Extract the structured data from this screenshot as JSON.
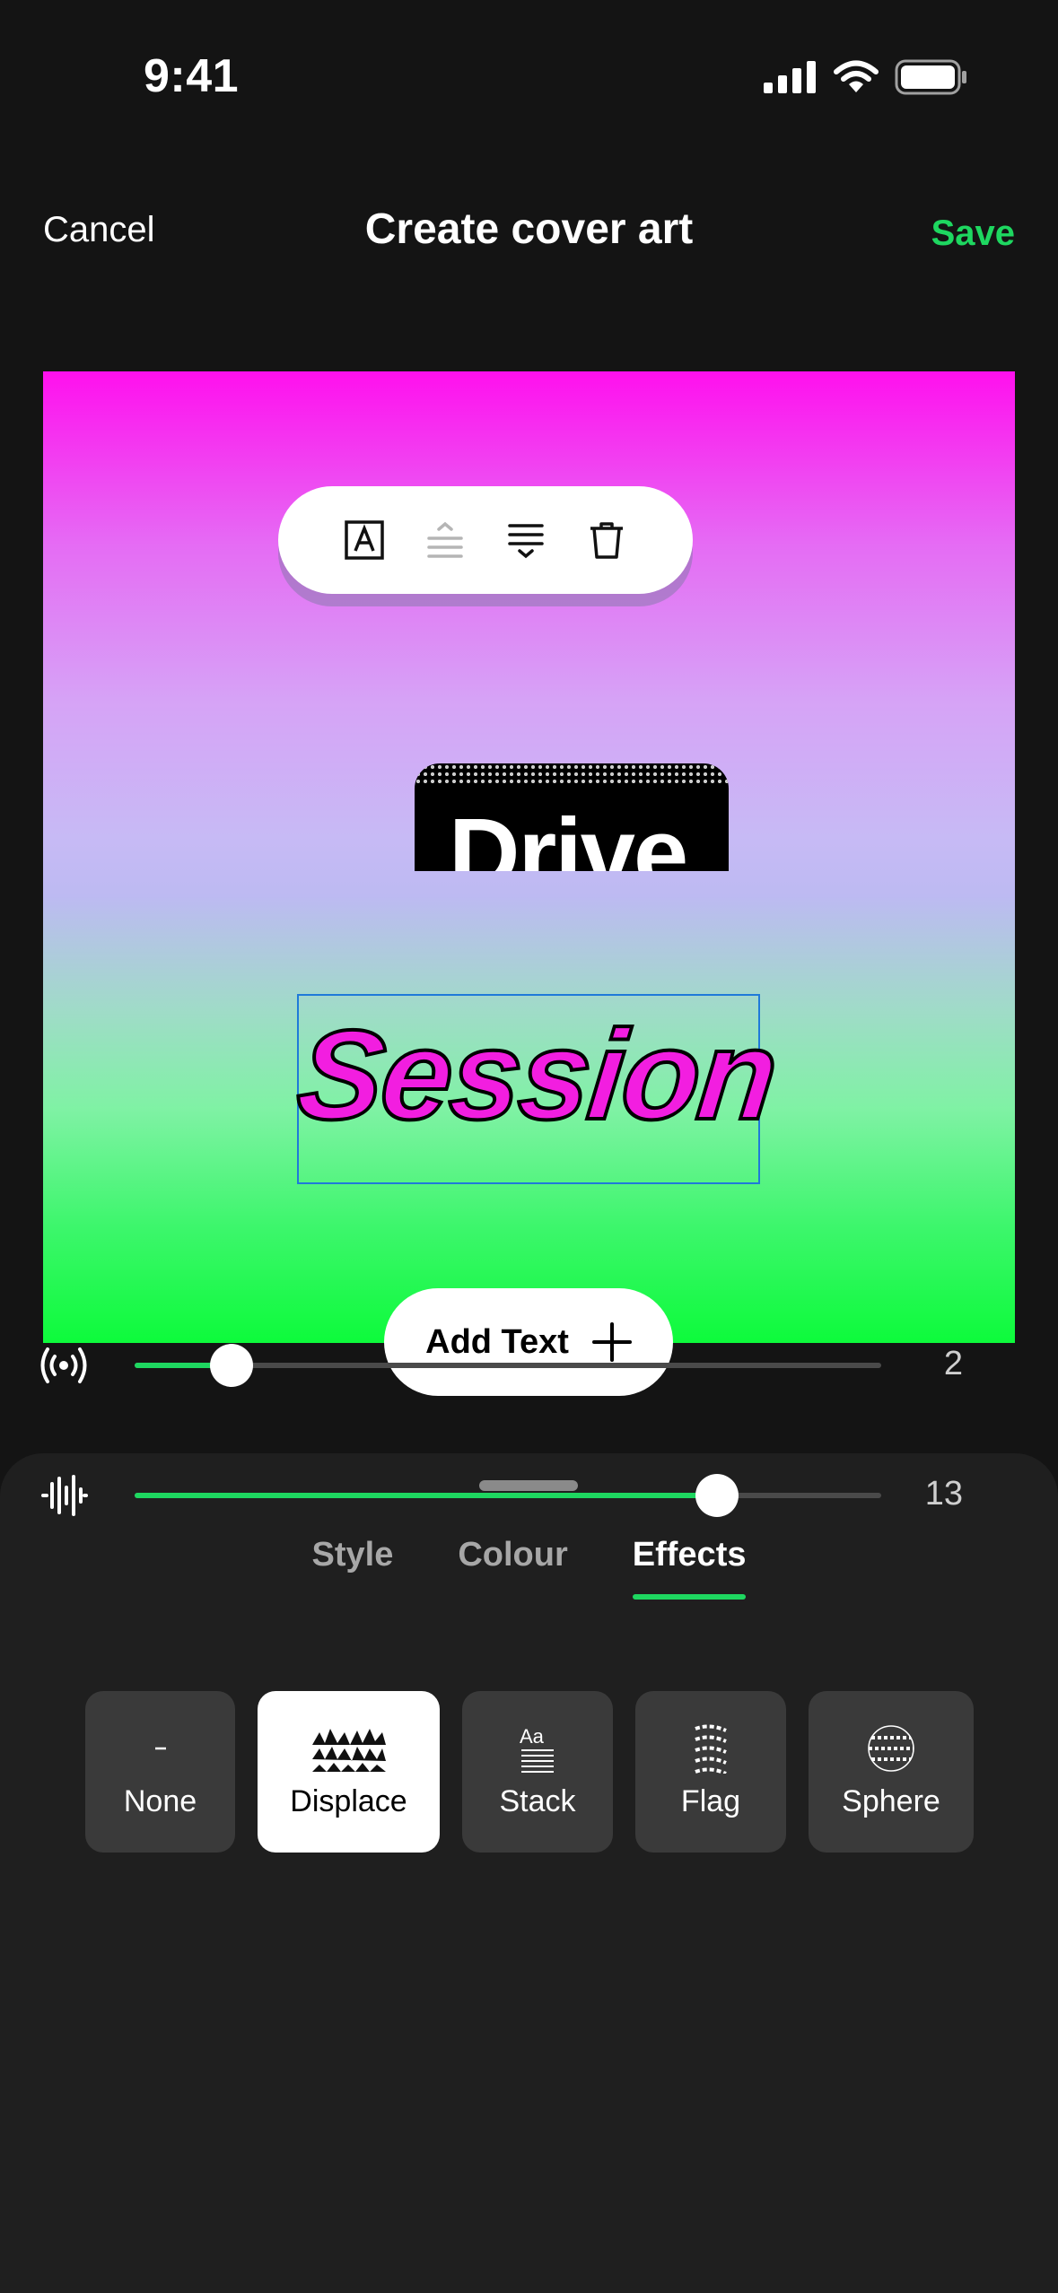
{
  "status_bar": {
    "time": "9:41"
  },
  "nav": {
    "cancel_label": "Cancel",
    "title": "Create cover art",
    "save_label": "Save",
    "accent": "#1ed760"
  },
  "canvas": {
    "background_top": "#ff10ee",
    "background_bottom": "#0dfb3b",
    "image_text": "Drive",
    "selected_text": "Session",
    "selected_text_color": "#f21ee0"
  },
  "text_toolbar": {
    "buttons": [
      "text-style-icon",
      "align-top-icon",
      "align-bottom-icon",
      "trash-icon"
    ]
  },
  "add_text": {
    "label": "Add Text"
  },
  "sheet": {
    "tabs": [
      {
        "label": "Style",
        "active": false
      },
      {
        "label": "Colour",
        "active": false
      },
      {
        "label": "Effects",
        "active": true
      }
    ],
    "effects": [
      {
        "label": "None",
        "selected": false,
        "icon": "dash-icon"
      },
      {
        "label": "Displace",
        "selected": true,
        "icon": "displace-icon"
      },
      {
        "label": "Stack",
        "selected": false,
        "icon": "stack-icon"
      },
      {
        "label": "Flag",
        "selected": false,
        "icon": "flag-icon"
      },
      {
        "label": "Sphere",
        "selected": false,
        "icon": "sphere-icon"
      }
    ],
    "sliders": [
      {
        "icon": "broadcast-icon",
        "value": "2",
        "fill_fraction": 0.13
      },
      {
        "icon": "waveform-icon",
        "value": "13",
        "fill_fraction": 0.78
      }
    ]
  }
}
